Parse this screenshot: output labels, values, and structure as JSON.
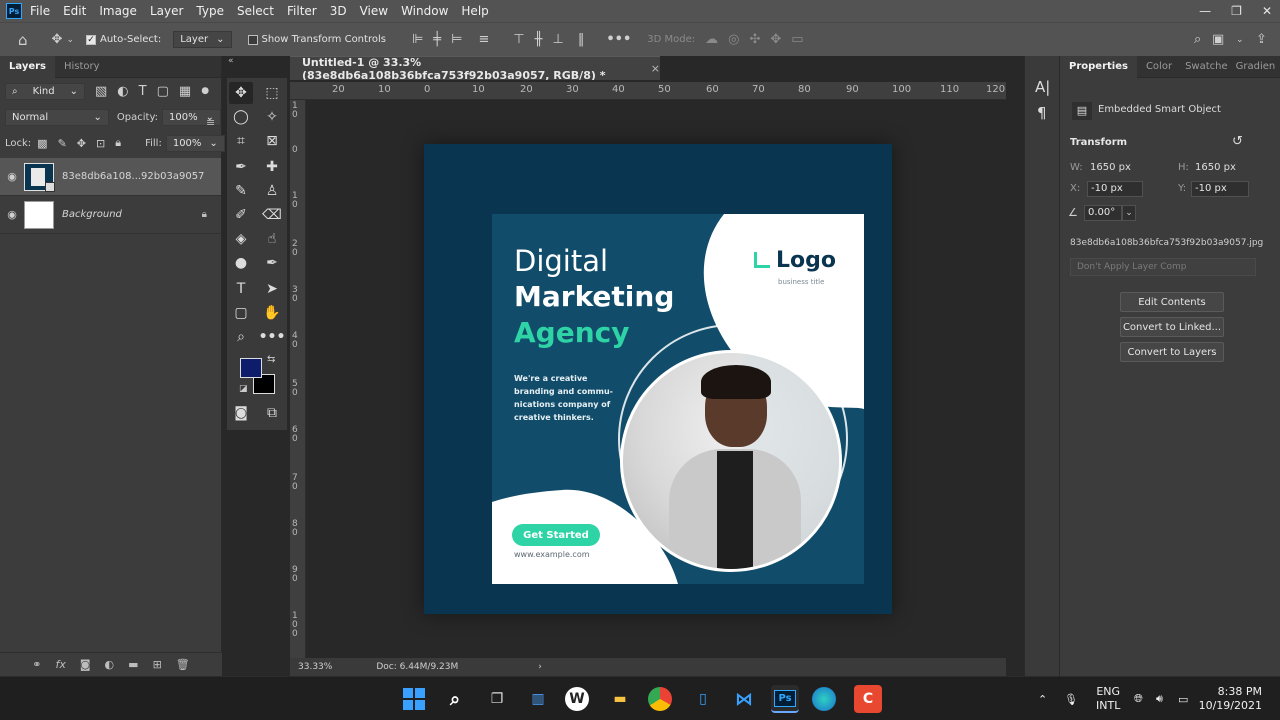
{
  "app": {
    "logo": "Ps",
    "menu": [
      "File",
      "Edit",
      "Image",
      "Layer",
      "Type",
      "Select",
      "Filter",
      "3D",
      "View",
      "Window",
      "Help"
    ],
    "window_controls": {
      "minimize": "—",
      "restore": "❐",
      "close": "✕"
    }
  },
  "options_bar": {
    "auto_select_label": "Auto-Select:",
    "auto_select_target": "Layer",
    "show_transform_label": "Show Transform Controls",
    "mode_3d_label": "3D Mode:"
  },
  "layers_panel": {
    "tabs": [
      "Layers",
      "History"
    ],
    "filter_kind": "Kind",
    "blend_mode": "Normal",
    "opacity_label": "Opacity:",
    "opacity_value": "100%",
    "lock_label": "Lock:",
    "fill_label": "Fill:",
    "fill_value": "100%",
    "layers": [
      {
        "name": "83e8db6a108...92b03a9057",
        "selected": true
      },
      {
        "name": "Background",
        "selected": false,
        "italic": true
      }
    ]
  },
  "document": {
    "tab_title": "Untitled-1 @ 33.3% (83e8db6a108b36bfca753f92b03a9057, RGB/8) *",
    "close_glyph": "×",
    "ruler_top": [
      "20",
      "10",
      "0",
      "10",
      "20",
      "30",
      "40",
      "50",
      "60",
      "70",
      "80",
      "90",
      "100",
      "110",
      "120"
    ],
    "ruler_left": [
      "1\n0",
      "0",
      "1\n0",
      "2\n0",
      "3\n0",
      "4\n0",
      "5\n0",
      "6\n0",
      "7\n0",
      "8\n0",
      "9\n0",
      "1\n0\n0"
    ],
    "zoom": "33.33%",
    "doc_size": "Doc: 6.44M/9.23M"
  },
  "design": {
    "headline_1": "Digital",
    "headline_2": "Marketing",
    "headline_3": "Agency",
    "body": "We're a creative branding and commu- nications company of creative thinkers.",
    "cta": "Get Started",
    "url": "www.example.com",
    "logo_text": "Logo",
    "logo_sub": "business title",
    "colors": {
      "navy": "#0a3550",
      "teal": "#114d6a",
      "green": "#2ed3a6"
    }
  },
  "properties_panel": {
    "tabs": [
      "Properties",
      "Color",
      "Swatche",
      "Gradien"
    ],
    "object_type": "Embedded Smart Object",
    "section": "Transform",
    "w_label": "W:",
    "w_value": "1650 px",
    "h_label": "H:",
    "h_value": "1650 px",
    "x_label": "X:",
    "x_value": "-10 px",
    "y_label": "Y:",
    "y_value": "-10 px",
    "angle_value": "0.00°",
    "filename": "83e8db6a108b36bfca753f92b03a9057.jpg",
    "layer_comp": "Don't Apply Layer Comp",
    "buttons": [
      "Edit Contents",
      "Convert to Linked...",
      "Convert to Layers"
    ]
  },
  "taskbar": {
    "lang_1": "ENG",
    "lang_2": "INTL",
    "time": "8:38 PM",
    "date": "10/19/2021"
  }
}
